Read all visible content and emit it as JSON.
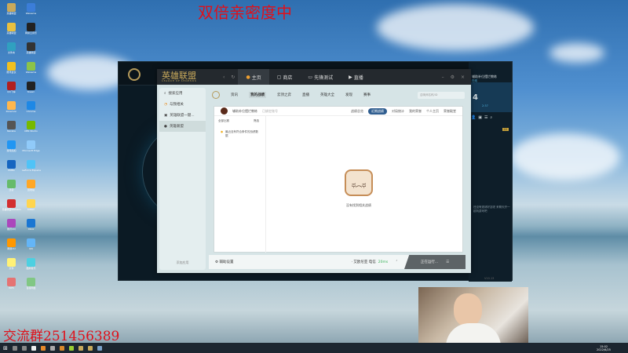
{
  "overlay": {
    "top_banner": "双倍亲密度中",
    "group_text": "交流群251456389"
  },
  "desktop_icons": [
    "英雄联盟",
    "WeGame",
    "英雄联盟",
    "网易云音乐",
    "文件夹",
    "英雄联盟",
    "腾讯会议",
    "WeGame",
    "QQ飞车",
    "Steam",
    "Pokemon",
    "Chrome",
    "Naraka",
    "OBS Studio",
    "游戏加加",
    "Microsoft Edge",
    "PUBG",
    "GeForce Experience",
    "迅雷",
    "回收站",
    "英雄联盟WeGame",
    "bilibili",
    "腾讯QQ",
    "Xbox",
    "网易UU",
    "QQ",
    "文件",
    "酷狗音乐",
    "WPS",
    "百度网盘"
  ],
  "wegame": {
    "brand": "英雄联盟",
    "brand_sub": "LEAGUE OF LEGENDS",
    "tabs": [
      {
        "label": "主页"
      },
      {
        "label": "商店"
      },
      {
        "label": "先锋测试"
      },
      {
        "label": "直播"
      }
    ],
    "sidebar": {
      "search": "搜索应用",
      "items": [
        "与我相关",
        "英雄联盟一键...",
        "英雄联盟"
      ],
      "add": "添加应用"
    },
    "subnav": [
      "资讯",
      "我的战绩",
      "云顶之弈",
      "直播",
      "英雄大全",
      "发现",
      "赛事"
    ],
    "search_placeholder": "召唤师名称/ID",
    "profile": {
      "name": "辅助补位摆烂教练",
      "tag": "已绑定账号"
    },
    "record_tabs": [
      "战绩总览",
      "近期战绩",
      "对局统计",
      "我的荣誉",
      "个人主页",
      "荣誉殿堂"
    ],
    "filter": "全部比赛",
    "filter_right": "筛选",
    "notice": "最近没有符合条件的战绩数据",
    "empty": "没有找到相关战绩",
    "bottom": {
      "settings": "辅助设置",
      "status": "· 艾欧尼亚 电信",
      "ping": "20ms",
      "running": "正在运行..."
    }
  },
  "lol_client": {
    "friend_count": "4",
    "time": "2:37",
    "badge": "22",
    "friend_name": "辅助补位摆烂教练",
    "friend_status": "在线",
    "empty_hint": "还没有邀请好友呢 来聊天开一起玩游戏吧",
    "version": "V10.13"
  },
  "taskbar": {
    "time": "15:02",
    "date": "2022/6/25"
  },
  "colors": {
    "banner_red": "#e0101a",
    "active_pill": "#2f5d8f",
    "gold": "#c8a95b"
  }
}
